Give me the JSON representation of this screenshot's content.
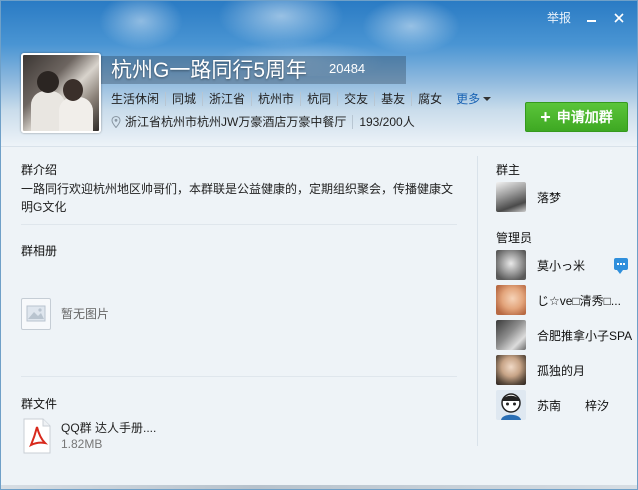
{
  "window": {
    "report_label": "举报"
  },
  "group": {
    "name": "杭州G一路同行5周年",
    "id": "20484",
    "tags": [
      "生活休闲",
      "同城",
      "浙江省",
      "杭州市",
      "杭同",
      "交友",
      "基友",
      "腐女"
    ],
    "more_label": "更多",
    "location": "浙江省杭州市杭州JW万豪酒店万豪中餐厅",
    "member_count": "193/200人",
    "join_label": "申请加群"
  },
  "intro": {
    "title": "群介绍",
    "text": "一路同行欢迎杭州地区帅哥们，本群联是公益健康的，定期组织聚会，传播健康文明G文化"
  },
  "album": {
    "title": "群相册",
    "empty_text": "暂无图片"
  },
  "files": {
    "title": "群文件",
    "items": [
      {
        "name": "QQ群 达人手册....",
        "size": "1.82MB"
      }
    ]
  },
  "owner": {
    "title": "群主",
    "name": "落梦"
  },
  "admins": {
    "title": "管理员",
    "members": [
      {
        "name": "莫小っ米"
      },
      {
        "name": "じ☆ve□清秀□..."
      },
      {
        "name": "合肥推拿小子SPA"
      },
      {
        "name": "孤独的月"
      },
      {
        "name": "苏南　　梓汐"
      }
    ]
  },
  "colors": {
    "join_button": "#4cb62e",
    "link": "#1b64b4",
    "header_top": "#2a7bc4"
  }
}
